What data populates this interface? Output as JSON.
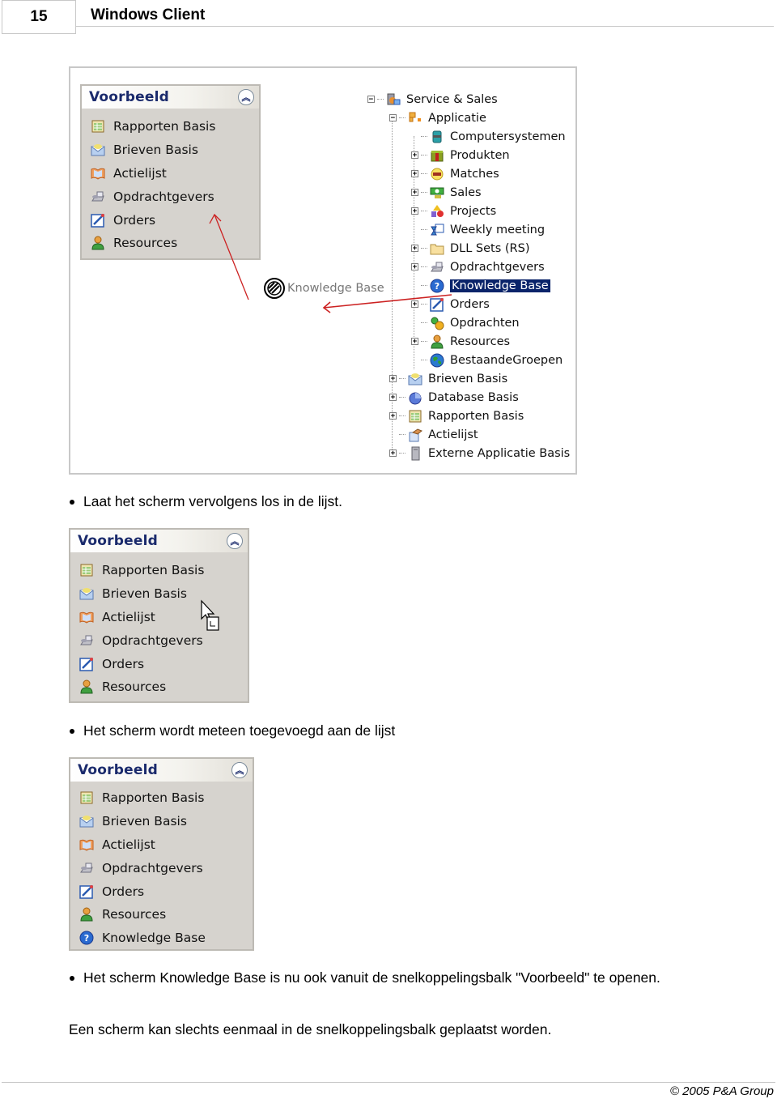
{
  "header": {
    "page_number": "15",
    "title": "Windows Client"
  },
  "figure1": {
    "panel": {
      "title": "Voorbeeld",
      "collapse_icon": "double-chevron-up-icon",
      "items": [
        {
          "label": "Rapporten Basis",
          "icon": "report-icon"
        },
        {
          "label": "Brieven Basis",
          "icon": "envelope-icon"
        },
        {
          "label": "Actielijst",
          "icon": "book-icon"
        },
        {
          "label": "Opdrachtgevers",
          "icon": "fax-icon"
        },
        {
          "label": "Orders",
          "icon": "edit-form-icon"
        },
        {
          "label": "Resources",
          "icon": "person-icon"
        }
      ]
    },
    "drag_label": "Knowledge Base",
    "drag_icon": "no-drop-icon",
    "tree": [
      {
        "label": "Service & Sales",
        "level": 0,
        "expander": "minus",
        "icon": "service-sales-icon"
      },
      {
        "label": "Applicatie",
        "level": 1,
        "expander": "minus",
        "icon": "blocks-icon"
      },
      {
        "label": "Computersystemen",
        "level": 2,
        "expander": "none",
        "icon": "cylinder-icon"
      },
      {
        "label": "Produkten",
        "level": 2,
        "expander": "plus",
        "icon": "gift-box-icon"
      },
      {
        "label": "Matches",
        "level": 2,
        "expander": "plus",
        "icon": "matches-icon"
      },
      {
        "label": "Sales",
        "level": 2,
        "expander": "plus",
        "icon": "money-icon"
      },
      {
        "label": "Projects",
        "level": 2,
        "expander": "plus",
        "icon": "shapes-icon"
      },
      {
        "label": "Weekly meeting",
        "level": 2,
        "expander": "none",
        "icon": "calendar-hourglass-icon"
      },
      {
        "label": "DLL Sets (RS)",
        "level": 2,
        "expander": "plus",
        "icon": "folder-icon"
      },
      {
        "label": "Opdrachtgevers",
        "level": 2,
        "expander": "plus",
        "icon": "fax-icon"
      },
      {
        "label": "Knowledge Base",
        "level": 2,
        "expander": "none",
        "icon": "help-icon",
        "selected": true
      },
      {
        "label": "Orders",
        "level": 2,
        "expander": "plus",
        "icon": "edit-form-icon"
      },
      {
        "label": "Opdrachten",
        "level": 2,
        "expander": "none",
        "icon": "gears-icon"
      },
      {
        "label": "Resources",
        "level": 2,
        "expander": "plus",
        "icon": "person-icon"
      },
      {
        "label": "BestaandeGroepen",
        "level": 2,
        "expander": "none",
        "icon": "globe-icon"
      },
      {
        "label": "Brieven Basis",
        "level": 1,
        "expander": "plus",
        "icon": "envelope-icon"
      },
      {
        "label": "Database Basis",
        "level": 1,
        "expander": "plus",
        "icon": "pie-chart-icon"
      },
      {
        "label": "Rapporten Basis",
        "level": 1,
        "expander": "plus",
        "icon": "report-icon"
      },
      {
        "label": "Actielijst",
        "level": 1,
        "expander": "none",
        "icon": "handshake-icon"
      },
      {
        "label": "Externe Applicatie Basis",
        "level": 1,
        "expander": "plus",
        "icon": "server-icon"
      }
    ]
  },
  "bullet1": "Laat het scherm vervolgens los in de lijst.",
  "figure2": {
    "panel": {
      "title": "Voorbeeld",
      "items": [
        {
          "label": "Rapporten Basis",
          "icon": "report-icon"
        },
        {
          "label": "Brieven Basis",
          "icon": "envelope-icon"
        },
        {
          "label": "Actielijst",
          "icon": "book-icon"
        },
        {
          "label": "Opdrachtgevers",
          "icon": "fax-icon"
        },
        {
          "label": "Orders",
          "icon": "edit-form-icon"
        },
        {
          "label": "Resources",
          "icon": "person-icon"
        }
      ],
      "cursor": "drag-copy-cursor-icon"
    }
  },
  "bullet2": "Het scherm wordt meteen toegevoegd aan de lijst",
  "figure3": {
    "panel": {
      "title": "Voorbeeld",
      "items": [
        {
          "label": "Rapporten Basis",
          "icon": "report-icon"
        },
        {
          "label": "Brieven Basis",
          "icon": "envelope-icon"
        },
        {
          "label": "Actielijst",
          "icon": "book-icon"
        },
        {
          "label": "Opdrachtgevers",
          "icon": "fax-icon"
        },
        {
          "label": "Orders",
          "icon": "edit-form-icon"
        },
        {
          "label": "Resources",
          "icon": "person-icon"
        },
        {
          "label": "Knowledge Base",
          "icon": "help-icon"
        }
      ]
    }
  },
  "bullet3": "Het scherm Knowledge Base is nu ook vanuit de snelkoppelingsbalk \"Voorbeeld\" te openen.",
  "note": "Een scherm kan slechts eenmaal in de snelkoppelingsbalk geplaatst worden.",
  "footer": {
    "copyright": "© 2005 P&A Group"
  },
  "colors": {
    "panel_title": "#1a2a6c",
    "panel_bg": "#d6d3ce",
    "selection_bg": "#0a246a",
    "arrow": "#cc2222"
  }
}
